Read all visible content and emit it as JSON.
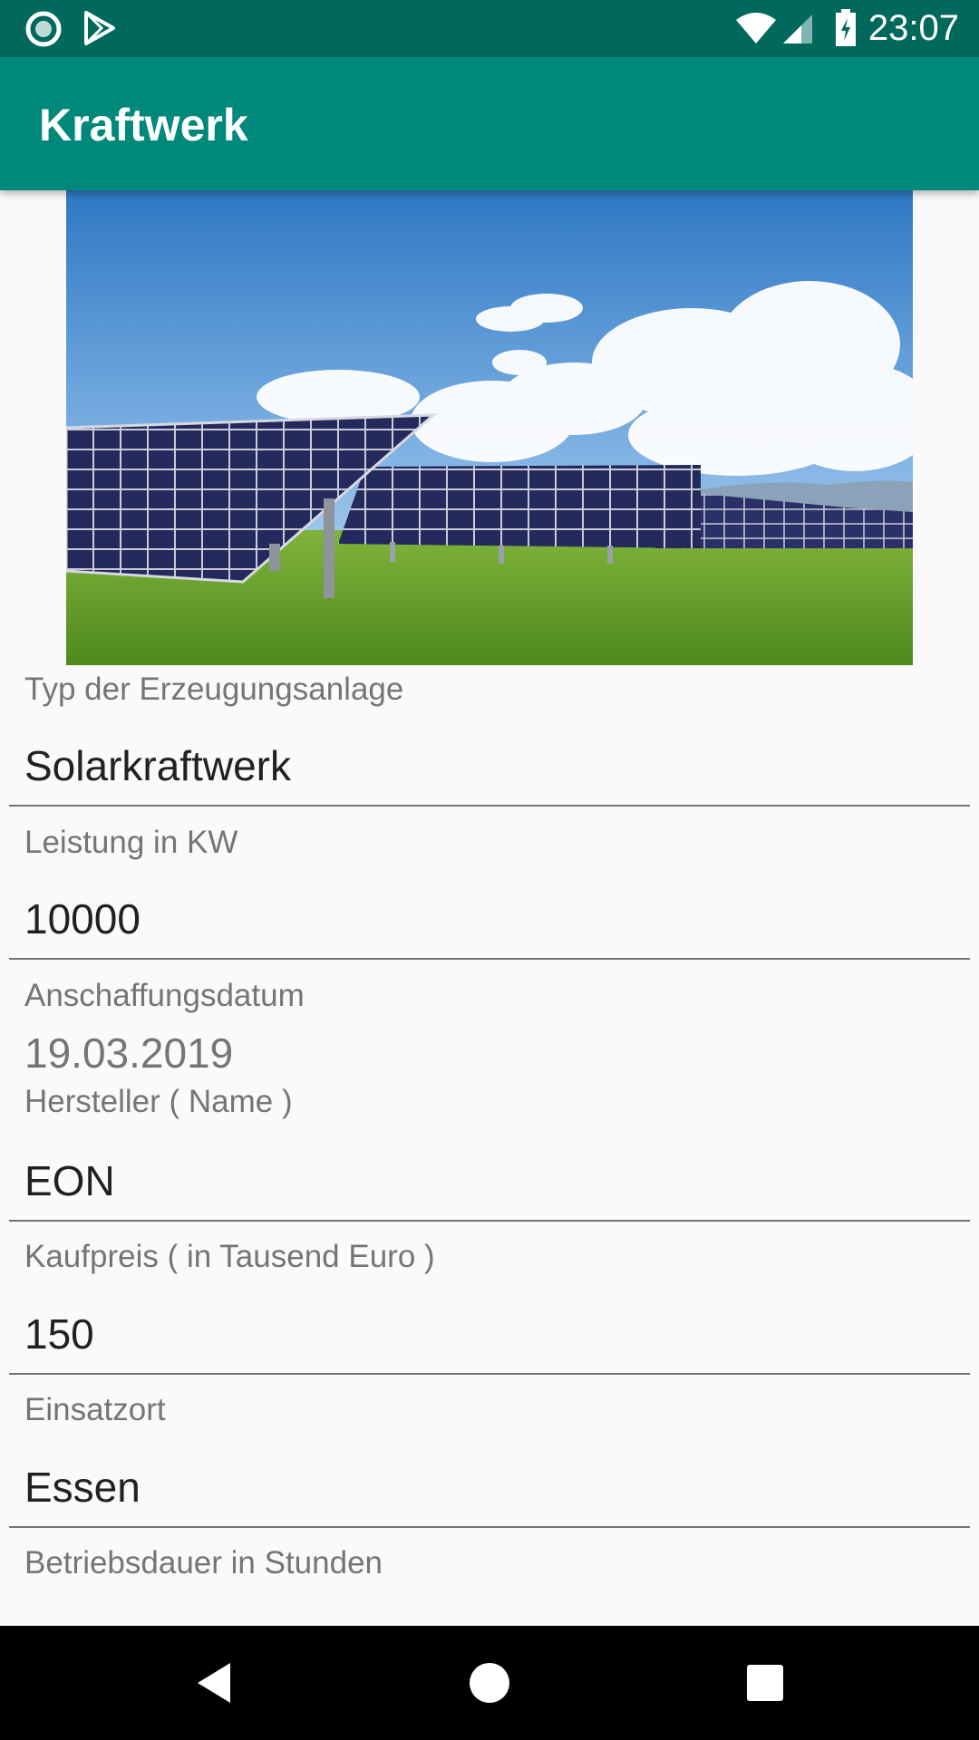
{
  "status_bar": {
    "time": "23:07",
    "icons": [
      "notification-dot-icon",
      "play-store-icon",
      "wifi-icon",
      "signal-icon",
      "battery-charging-icon"
    ]
  },
  "app_bar": {
    "title": "Kraftwerk"
  },
  "hero": {
    "image_icon": "solar-panel-field-image"
  },
  "form": {
    "typ_label": "Typ der Erzeugungsanlage",
    "typ_value": "Solarkraftwerk",
    "leistung_label": "Leistung in KW",
    "leistung_value": "10000",
    "datum_label": "Anschaffungsdatum",
    "datum_value": "19.03.2019",
    "hersteller_label": "Hersteller ( Name )",
    "hersteller_value": "EON",
    "kaufpreis_label": "Kaufpreis ( in Tausend Euro )",
    "kaufpreis_value": "150",
    "einsatzort_label": "Einsatzort",
    "einsatzort_value": "Essen",
    "betriebsdauer_label": "Betriebsdauer in Stunden"
  },
  "nav_bar": {
    "icons": [
      "back-icon",
      "home-icon",
      "recents-icon"
    ]
  },
  "colors": {
    "status_bar": "#00695c",
    "app_bar": "#00897b",
    "background": "#fafafa",
    "label": "#757575",
    "value": "#212121"
  }
}
